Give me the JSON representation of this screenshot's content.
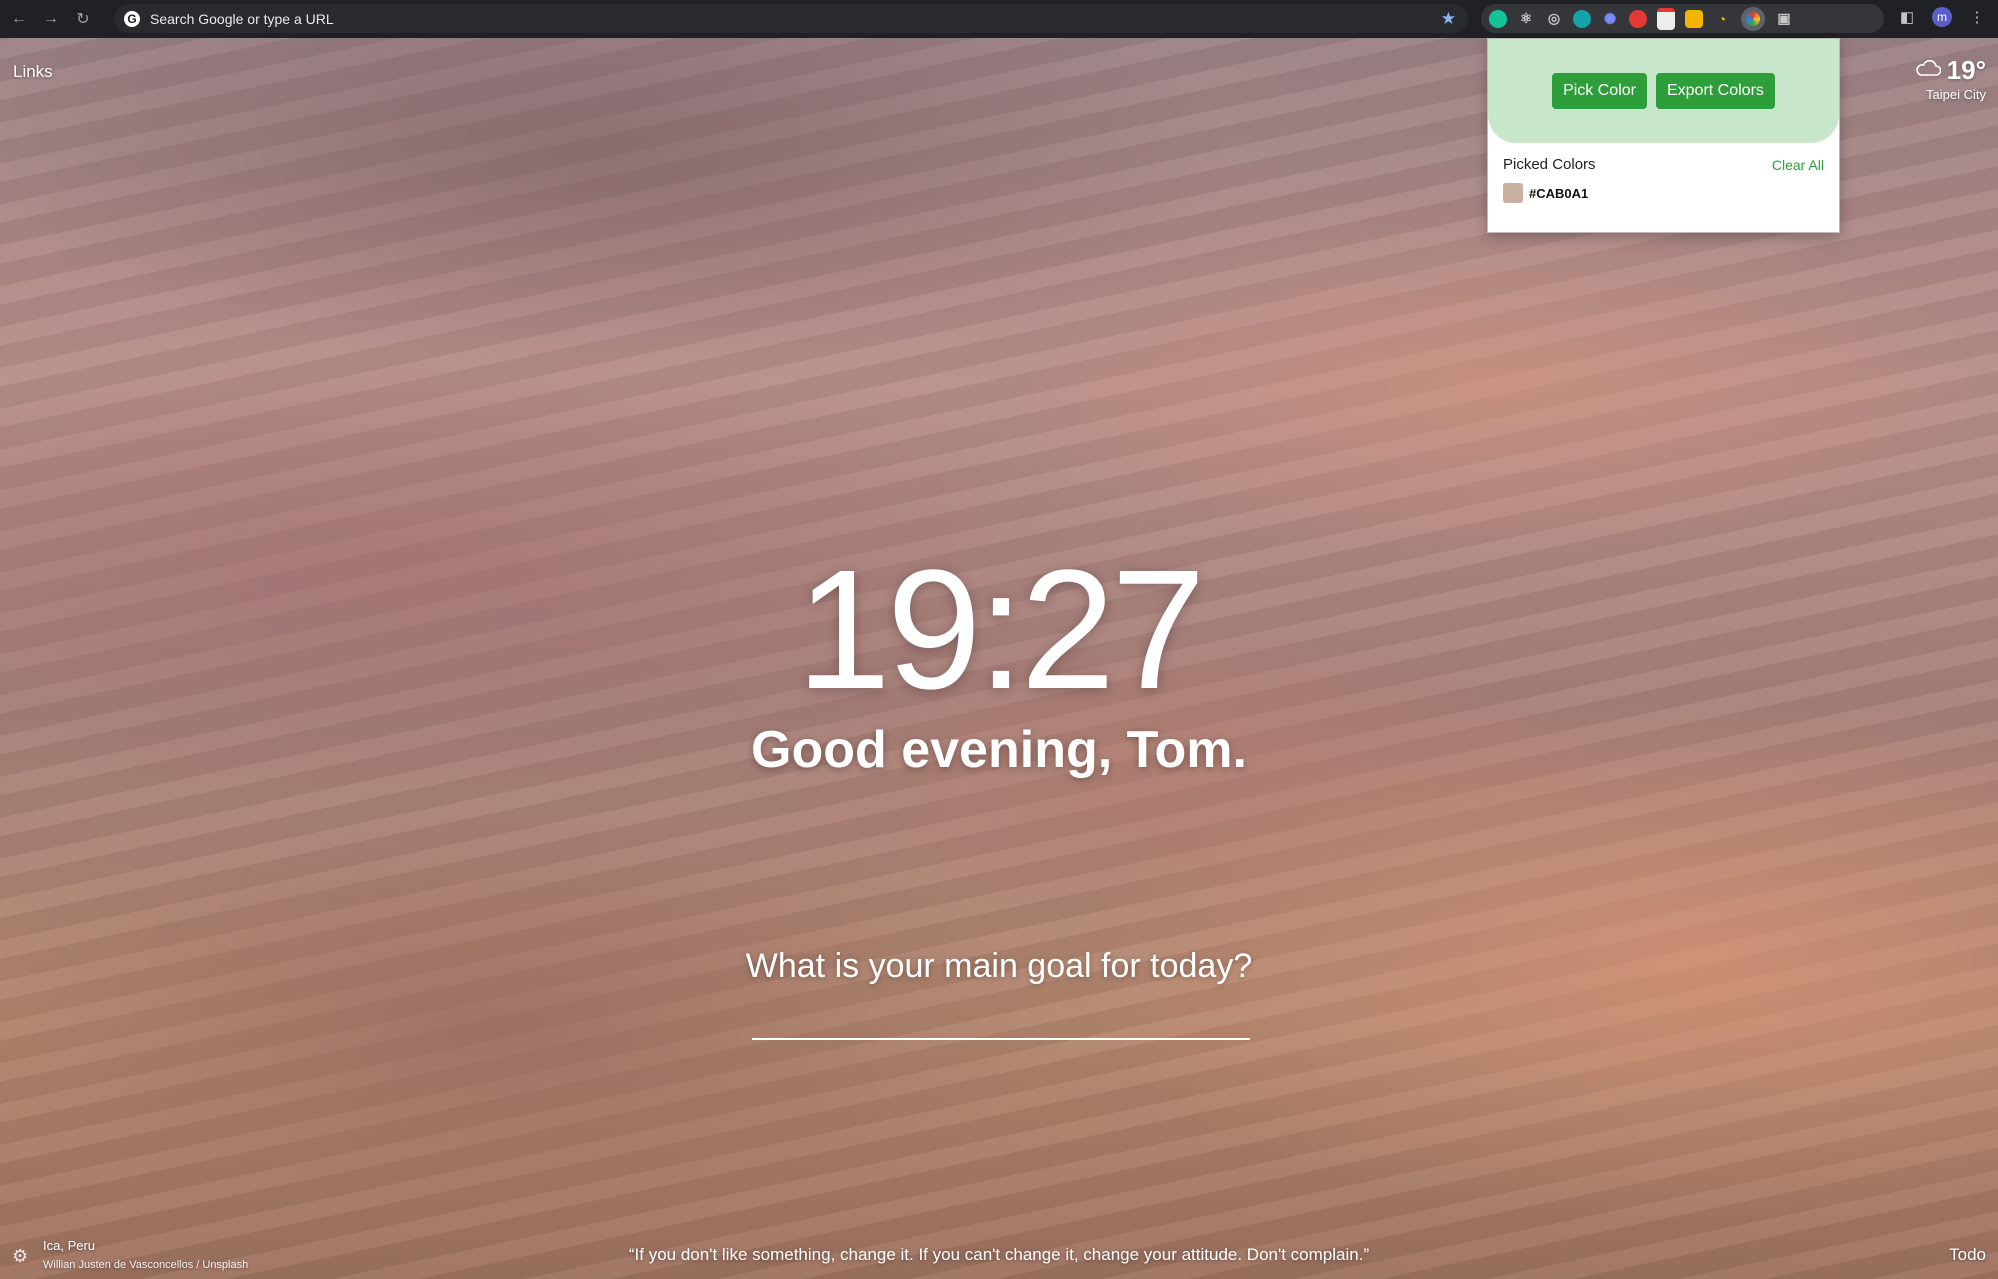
{
  "browser": {
    "omnibox_placeholder": "Search Google or type a URL",
    "google_letter": "G",
    "avatar_letter": "m"
  },
  "momentum": {
    "links_label": "Links",
    "weather": {
      "temperature": "19°",
      "city": "Taipei City"
    },
    "clock": "19:27",
    "greeting": "Good evening, Tom.",
    "goal_question": "What is your main goal for today?",
    "photo_location": "Ica, Peru",
    "photo_credit": "Willian Justen de Vasconcellos / Unsplash",
    "quote": "“If you don't like something, change it. If you can't change it, change your attitude. Don't complain.”",
    "todo_label": "Todo"
  },
  "popup": {
    "pick_color_label": "Pick Color",
    "export_colors_label": "Export Colors",
    "picked_title": "Picked Colors",
    "clear_all_label": "Clear All",
    "colors": [
      {
        "hex": "#CAB0A1"
      }
    ]
  },
  "colors": {
    "accent_green": "#2e9e3b",
    "popup_header_green": "#c8e6c9",
    "toolbar_bg": "#202124"
  }
}
